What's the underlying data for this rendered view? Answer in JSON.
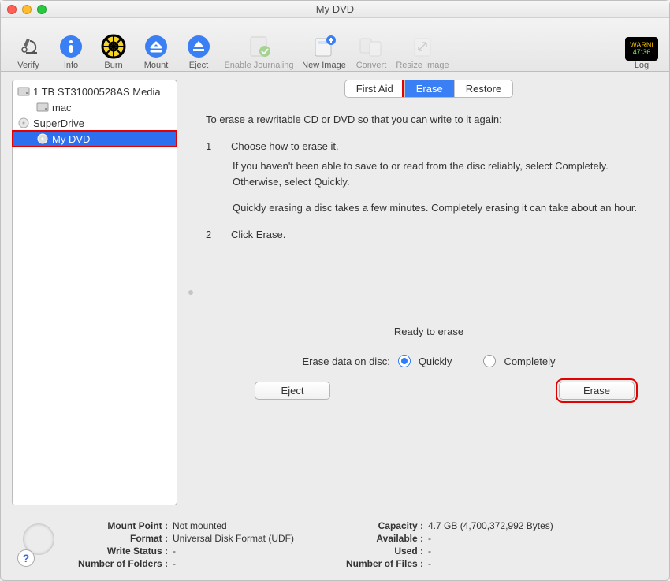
{
  "window": {
    "title": "My DVD"
  },
  "toolbar": {
    "verify": "Verify",
    "info": "Info",
    "burn": "Burn",
    "mount": "Mount",
    "eject": "Eject",
    "enable_journaling": "Enable Journaling",
    "new_image": "New Image",
    "convert": "Convert",
    "resize_image": "Resize Image",
    "log": "Log"
  },
  "sidebar": {
    "items": [
      {
        "label": "1 TB ST31000528AS Media"
      },
      {
        "label": "mac"
      },
      {
        "label": "SuperDrive"
      },
      {
        "label": "My DVD"
      }
    ]
  },
  "tabs": {
    "first_aid": "First Aid",
    "erase": "Erase",
    "restore": "Restore"
  },
  "instructions": {
    "intro": "To erase a rewritable CD or DVD so that you can write to it again:",
    "step1_num": "1",
    "step1": "Choose how to erase it.",
    "step1_detail1": "If you haven't been able to save to or read from the disc reliably, select Completely. Otherwise, select Quickly.",
    "step1_detail2": "Quickly erasing a disc takes a few minutes. Completely erasing it can take about an hour.",
    "step2_num": "2",
    "step2": "Click Erase."
  },
  "erase_panel": {
    "ready": "Ready to erase",
    "label": "Erase data on disc:",
    "opt_quickly": "Quickly",
    "opt_completely": "Completely",
    "eject_btn": "Eject",
    "erase_btn": "Erase"
  },
  "footer": {
    "mount_point_k": "Mount Point :",
    "mount_point_v": "Not mounted",
    "format_k": "Format :",
    "format_v": "Universal Disk Format (UDF)",
    "write_status_k": "Write Status :",
    "write_status_v": "-",
    "num_folders_k": "Number of Folders :",
    "num_folders_v": "-",
    "capacity_k": "Capacity :",
    "capacity_v": "4.7 GB (4,700,372,992 Bytes)",
    "available_k": "Available :",
    "available_v": "-",
    "used_k": "Used :",
    "used_v": "-",
    "num_files_k": "Number of Files :",
    "num_files_v": "-"
  },
  "log_badge": {
    "line1": "WARNI",
    "line2": "47:36"
  },
  "help": "?"
}
